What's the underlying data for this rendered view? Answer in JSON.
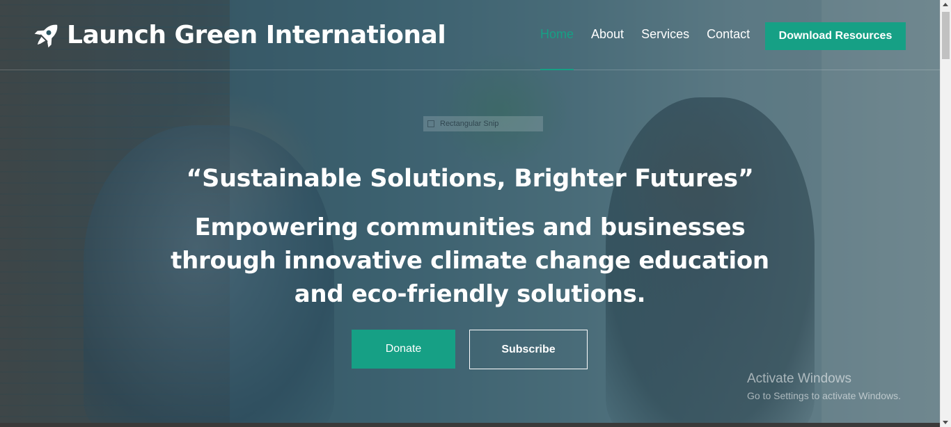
{
  "brand": {
    "name": "Launch Green International",
    "icon": "rocket-icon"
  },
  "nav": {
    "items": [
      {
        "label": "Home",
        "active": true
      },
      {
        "label": "About",
        "active": false
      },
      {
        "label": "Services",
        "active": false
      },
      {
        "label": "Contact",
        "active": false
      }
    ],
    "cta_label": "Download Resources"
  },
  "snip_tooltip": {
    "label": "Rectangular Snip"
  },
  "hero": {
    "tagline": "“Sustainable Solutions, Brighter Futures”",
    "headline": "Empowering communities and businesses through innovative climate change education and eco-friendly solutions.",
    "donate_label": "Donate",
    "subscribe_label": "Subscribe"
  },
  "watermark": {
    "title": "Activate Windows",
    "subtitle": "Go to Settings to activate Windows."
  },
  "colors": {
    "accent": "#16a085",
    "overlay": "#183e4a"
  }
}
